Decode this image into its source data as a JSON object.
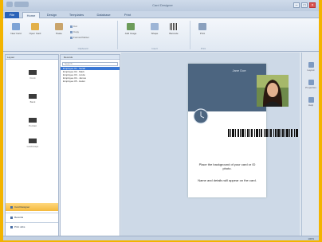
{
  "window": {
    "title": "Card Designer"
  },
  "tabs": [
    "File",
    "Home",
    "Design",
    "Templates",
    "Database",
    "Print"
  ],
  "ribbon": {
    "buttons": [
      "New Card",
      "Open Card",
      "Paste",
      "Add Image",
      "Shape",
      "Barcode",
      "Print"
    ],
    "small_items": [
      "Cut",
      "Copy",
      "Format Painter"
    ],
    "groups": [
      "Clipboard",
      "Insert",
      "Print"
    ]
  },
  "left_panel": {
    "header": "Layout",
    "thumbnails": [
      "Front",
      "Back",
      "Portrait",
      "Landscape"
    ],
    "nav": [
      "Card Designer",
      "Records",
      "Print Jobs"
    ]
  },
  "list_panel": {
    "header": "Records",
    "search_placeholder": "Search",
    "rows": [
      "Employee 01 - Sarah",
      "Employee 02 - Mark",
      "Employee 03 - Linda",
      "Employee 04 - James",
      "Employee 05 - Helen"
    ]
  },
  "card": {
    "name": "Jane Doe",
    "text1": "Place the background of your card or ID photo.",
    "text2": "Name and details will appear on the card."
  },
  "right_strip": [
    "Layout",
    "Properties",
    "Help"
  ],
  "status": {
    "zoom": "100%"
  },
  "colors": {
    "frame": "#f3b400",
    "card_header": "#4c6580",
    "selection": "#3a78d5",
    "nav_selected": "#f4b93e"
  }
}
